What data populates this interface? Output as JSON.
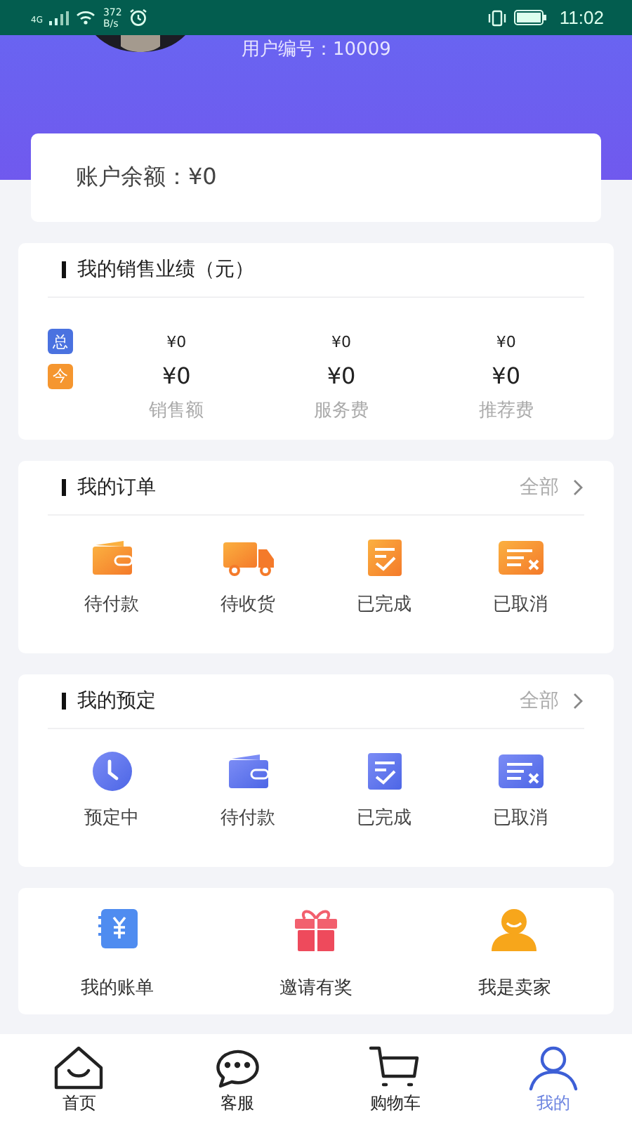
{
  "status_bar": {
    "network": "4G",
    "speed_value": "372",
    "speed_unit": "B/s",
    "time": "11:02"
  },
  "profile": {
    "user_number": "用户编号：10009"
  },
  "balance": {
    "text": "账户余额：¥0"
  },
  "sales": {
    "title": "我的销售业绩（元）",
    "rows": [
      {
        "badge": "总",
        "kind": "total",
        "color": "#4a72e0",
        "values": [
          "¥0",
          "¥0",
          "¥0"
        ]
      },
      {
        "badge": "今",
        "kind": "today",
        "color": "#f5962f",
        "values": [
          "¥0",
          "¥0",
          "¥0"
        ]
      }
    ],
    "labels": [
      "销售额",
      "服务费",
      "推荐费"
    ]
  },
  "orders": {
    "title": "我的订单",
    "more": "全部",
    "items": [
      {
        "label": "待付款",
        "kind": "wallet"
      },
      {
        "label": "待收货",
        "kind": "truck"
      },
      {
        "label": "已完成",
        "kind": "done"
      },
      {
        "label": "已取消",
        "kind": "cancel"
      }
    ]
  },
  "reservations": {
    "title": "我的预定",
    "more": "全部",
    "items": [
      {
        "label": "预定中",
        "kind": "clock"
      },
      {
        "label": "待付款",
        "kind": "wallet"
      },
      {
        "label": "已完成",
        "kind": "done"
      },
      {
        "label": "已取消",
        "kind": "cancel"
      }
    ]
  },
  "tools": [
    {
      "label": "我的账单",
      "kind": "bill"
    },
    {
      "label": "邀请有奖",
      "kind": "gift"
    },
    {
      "label": "我是卖家",
      "kind": "seller"
    }
  ],
  "tabs": [
    {
      "label": "首页",
      "kind": "home",
      "selected": false
    },
    {
      "label": "客服",
      "kind": "chat",
      "selected": false
    },
    {
      "label": "购物车",
      "kind": "cart",
      "selected": false
    },
    {
      "label": "我的",
      "kind": "me",
      "selected": true
    }
  ]
}
